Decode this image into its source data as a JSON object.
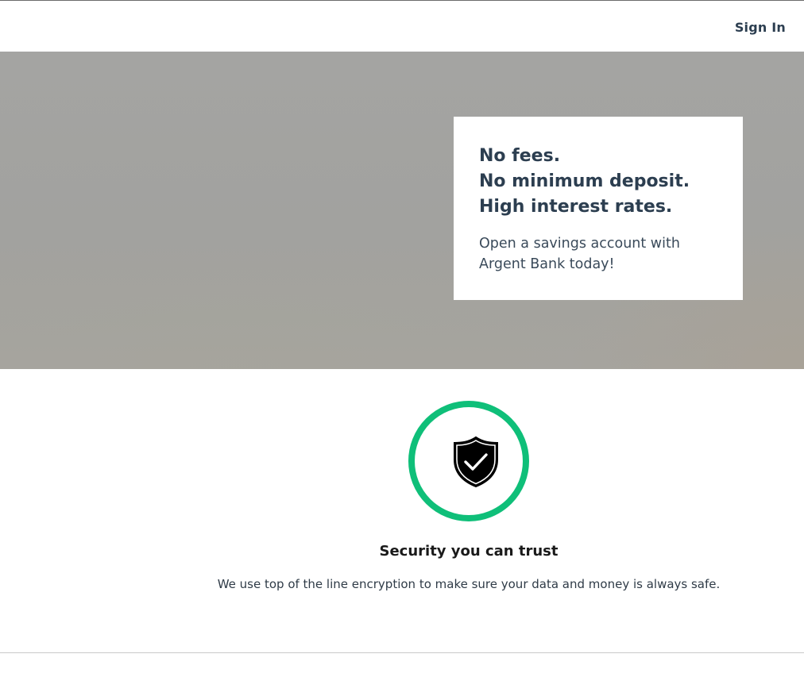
{
  "header": {
    "sign_in_label": "Sign In"
  },
  "hero": {
    "lines": [
      "No fees.",
      "No minimum deposit.",
      "High interest rates."
    ],
    "subtext": "Open a savings account with Argent Bank today!"
  },
  "feature": {
    "icon": "shield-check-icon",
    "title": "Security you can trust",
    "text": "We use top of the line encryption to make sure your data and money is always safe."
  },
  "colors": {
    "accent": "#0fbf79",
    "text": "#2c3e50"
  }
}
